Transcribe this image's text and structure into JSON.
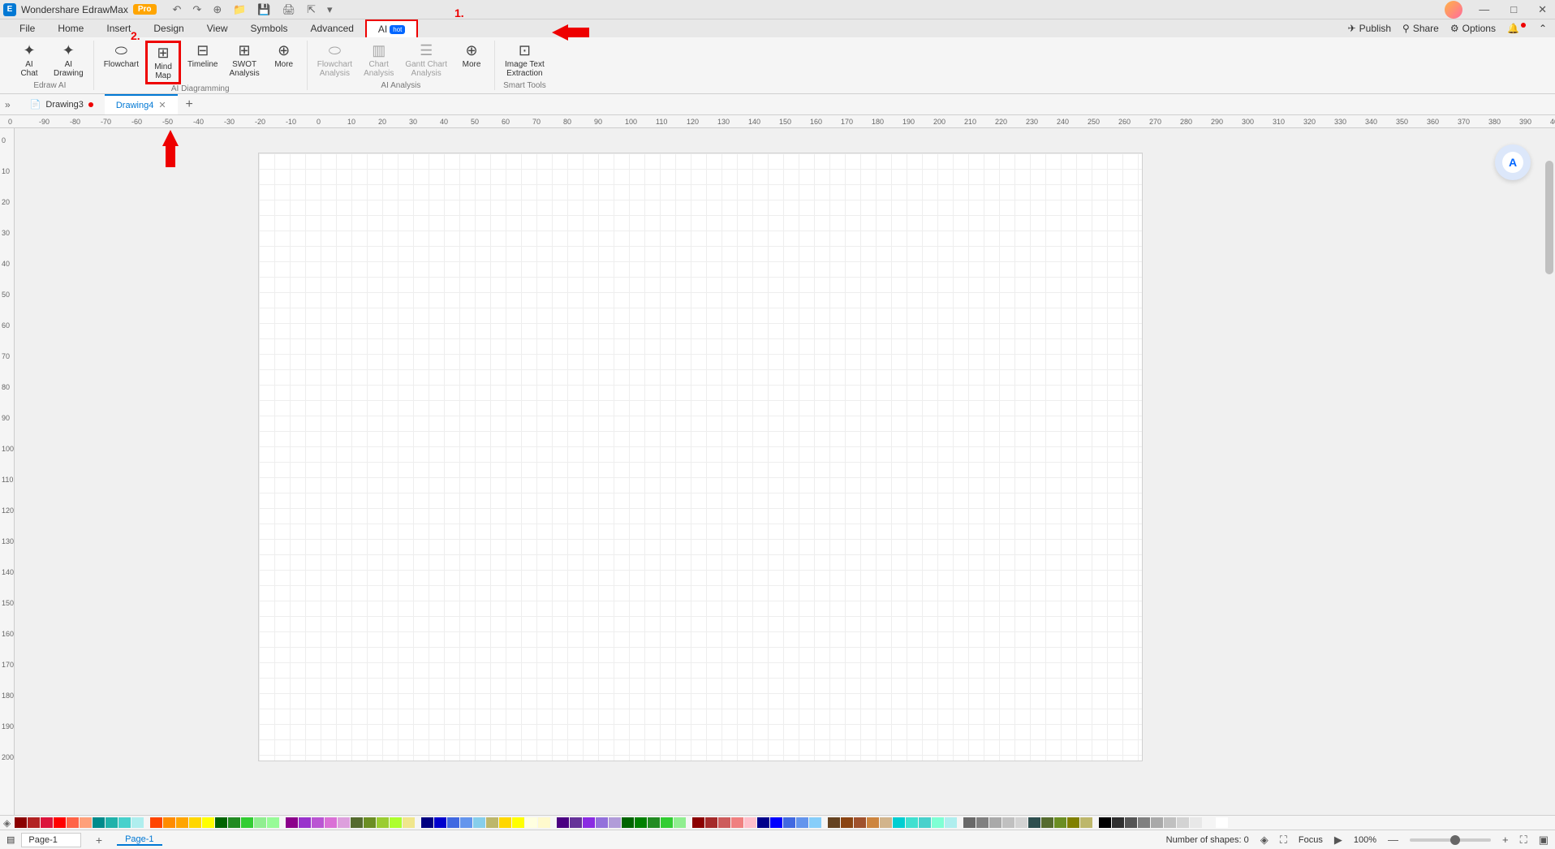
{
  "app": {
    "title": "Wondershare EdrawMax",
    "badge": "Pro"
  },
  "menu": {
    "items": [
      "File",
      "Home",
      "Insert",
      "Design",
      "View",
      "Symbols",
      "Advanced"
    ],
    "ai": "AI",
    "ai_badge": "hot"
  },
  "menu_right": {
    "publish": "Publish",
    "share": "Share",
    "options": "Options"
  },
  "ribbon": {
    "edraw_ai": {
      "label": "Edraw AI",
      "tools": [
        {
          "icon": "✦",
          "label": "AI\nChat"
        },
        {
          "icon": "✦",
          "label": "AI\nDrawing"
        }
      ]
    },
    "diagramming": {
      "label": "AI Diagramming",
      "tools": [
        {
          "icon": "⬭",
          "label": "Flowchart"
        },
        {
          "icon": "⊞",
          "label": "Mind\nMap",
          "highlighted": true
        },
        {
          "icon": "⊟",
          "label": "Timeline"
        },
        {
          "icon": "⊞",
          "label": "SWOT\nAnalysis"
        },
        {
          "icon": "⊕",
          "label": "More"
        }
      ]
    },
    "analysis": {
      "label": "AI Analysis",
      "tools": [
        {
          "icon": "⬭",
          "label": "Flowchart\nAnalysis",
          "disabled": true
        },
        {
          "icon": "▥",
          "label": "Chart\nAnalysis",
          "disabled": true
        },
        {
          "icon": "☰",
          "label": "Gantt Chart\nAnalysis",
          "disabled": true
        },
        {
          "icon": "⊕",
          "label": "More"
        }
      ]
    },
    "smart": {
      "label": "Smart Tools",
      "tools": [
        {
          "icon": "⊡",
          "label": "Image Text\nExtraction"
        }
      ]
    }
  },
  "tabs": {
    "tab1": "Drawing3",
    "tab2": "Drawing4"
  },
  "ruler_h": [
    "0",
    "-90",
    "-80",
    "-70",
    "-60",
    "-50",
    "-40",
    "-30",
    "-20",
    "-10",
    "0",
    "10",
    "20",
    "30",
    "40",
    "50",
    "60",
    "70",
    "80",
    "90",
    "100",
    "110",
    "120",
    "130",
    "140",
    "150",
    "160",
    "170",
    "180",
    "190",
    "200",
    "210",
    "220",
    "230",
    "240",
    "250",
    "260",
    "270",
    "280",
    "290",
    "300",
    "310",
    "320",
    "330",
    "340",
    "350",
    "360",
    "370",
    "380",
    "390",
    "40"
  ],
  "ruler_v": [
    "0",
    "10",
    "20",
    "30",
    "40",
    "50",
    "60",
    "70",
    "80",
    "90",
    "100",
    "110",
    "120",
    "130",
    "140",
    "150",
    "160",
    "170",
    "180",
    "190",
    "200"
  ],
  "color_rows": [
    [
      "#8b0000",
      "#b22222",
      "#dc143c",
      "#ff0000",
      "#ff6347",
      "#ffa07a",
      "#008b8b",
      "#20b2aa",
      "#48d1cc",
      "#afeeee"
    ],
    [
      "#ff4500",
      "#ff8c00",
      "#ffa500",
      "#ffd700",
      "#ffff00",
      "#006400",
      "#228b22",
      "#32cd32",
      "#90ee90",
      "#98fb98"
    ],
    [
      "#8b008b",
      "#9932cc",
      "#ba55d3",
      "#da70d6",
      "#dda0dd",
      "#556b2f",
      "#6b8e23",
      "#9acd32",
      "#adff2f",
      "#f0e68c"
    ],
    [
      "#000080",
      "#0000cd",
      "#4169e1",
      "#6495ed",
      "#87ceeb",
      "#bdb76b",
      "#ffd700",
      "#ffff00",
      "#ffffe0",
      "#fffacd"
    ],
    [
      "#4b0082",
      "#663399",
      "#8a2be2",
      "#9370db",
      "#b19cd9",
      "#006400",
      "#008000",
      "#228b22",
      "#32cd32",
      "#90ee90"
    ],
    [
      "#8b0000",
      "#a52a2a",
      "#cd5c5c",
      "#f08080",
      "#ffc0cb",
      "#00008b",
      "#0000ff",
      "#4169e1",
      "#6495ed",
      "#87cefa"
    ],
    [
      "#654321",
      "#8b4513",
      "#a0522d",
      "#cd853f",
      "#d2b48c",
      "#00ced1",
      "#40e0d0",
      "#48d1cc",
      "#7fffd4",
      "#afeeee"
    ],
    [
      "#696969",
      "#808080",
      "#a9a9a9",
      "#c0c0c0",
      "#d3d3d3",
      "#2f4f4f",
      "#556b2f",
      "#6b8e23",
      "#808000",
      "#bdb76b"
    ],
    [
      "#000000",
      "#2f2f2f",
      "#555555",
      "#808080",
      "#a9a9a9",
      "#c0c0c0",
      "#d3d3d3",
      "#e8e8e8",
      "#f5f5f5",
      "#ffffff"
    ]
  ],
  "status": {
    "page_dropdown": "Page-1",
    "page_tab": "Page-1",
    "shapes": "Number of shapes: 0",
    "focus": "Focus",
    "zoom": "100%"
  },
  "annotations": {
    "one": "1.",
    "two": "2."
  }
}
